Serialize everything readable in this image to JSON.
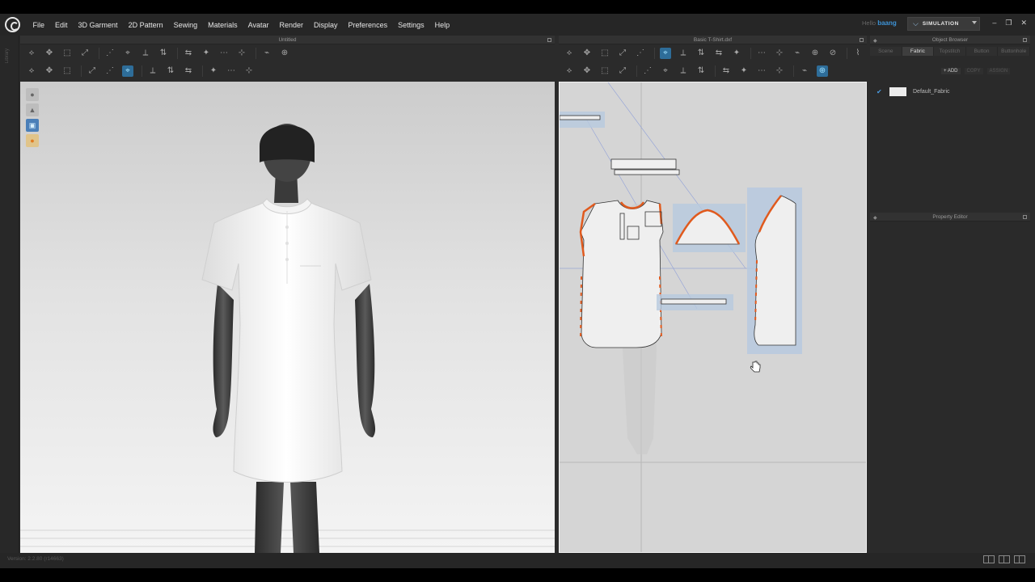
{
  "menu": [
    "File",
    "Edit",
    "3D Garment",
    "2D Pattern",
    "Sewing",
    "Materials",
    "Avatar",
    "Render",
    "Display",
    "Preferences",
    "Settings",
    "Help"
  ],
  "user": {
    "prefix": "Hello",
    "name": "baang"
  },
  "simulation": {
    "label": "SIMULATION"
  },
  "window_controls": [
    "–",
    "❐",
    "✕"
  ],
  "gutter": {
    "label": "Library"
  },
  "panels": {
    "viewport3d_title": "Untitled",
    "viewport2d_title": "Basic T-Shirt.dxf",
    "object_browser_title": "Object Browser",
    "property_editor_title": "Property Editor"
  },
  "object_browser": {
    "tabs": [
      {
        "label": "Scene",
        "active": false
      },
      {
        "label": "Fabric",
        "active": true
      },
      {
        "label": "Topstitch",
        "active": false
      },
      {
        "label": "Button",
        "active": false
      },
      {
        "label": "Buttonhole",
        "active": false
      }
    ],
    "actions": [
      {
        "label": "+ ADD",
        "enabled": true
      },
      {
        "label": "COPY",
        "enabled": false
      },
      {
        "label": "ASSIGN",
        "enabled": false
      }
    ],
    "fabric": {
      "name": "Default_Fabric",
      "swatch_color": "#ececec"
    }
  },
  "status": {
    "version": "Version: 2.2.80 (r14663)"
  },
  "icons": {
    "toolbar3d_row1": [
      "select-mesh-icon",
      "transform-pattern-icon",
      "edit-pattern-icon",
      "sewing-line-icon",
      "segment-sewing-icon",
      "tack-icon",
      "pin-icon",
      "strengthen-icon",
      "fold-arrange-icon",
      "avatar-pose-icon",
      "fit-icon",
      "select-arrangement-point-icon",
      "zipper-icon",
      "measure-icon"
    ],
    "toolbar3d_row2": [
      "edit-sewing-icon",
      "free-sewing-icon",
      "check-sewing-icon",
      "point-icon",
      "line-icon",
      "texture-icon",
      "sphere-icon",
      "button-icon",
      "stitch-line-icon",
      "cut-icon",
      "scissor-icon",
      "select-icon"
    ],
    "toolbar2d_row1": [
      "transform-icon",
      "edit-point-icon",
      "edit-curvature-icon",
      "add-point-icon",
      "curve-point-icon",
      "segment-icon",
      "rectangle-icon",
      "polygon-icon",
      "circle-icon",
      "internal-rectangle-icon",
      "internal-polygon-icon",
      "dart-icon",
      "trace-icon",
      "rotate-icon",
      "internal-line-icon",
      "sync-icon"
    ],
    "toolbar2d_row2": [
      "segment-sewing-icon",
      "free-sewing-icon",
      "m-n-sewing-icon",
      "edit-sewing-icon",
      "check-sewing-icon",
      "notch-icon",
      "topstitch-icon",
      "edit-topstitch-icon",
      "mirror-icon",
      "grid-icon",
      "zoom-icon",
      "snap-icon",
      "layer-icon",
      "arrange-icon"
    ],
    "viewport_tools": [
      "display-avatar-icon",
      "display-garment-icon",
      "display-texture-icon",
      "light-icon"
    ],
    "cursor": "hand-cursor-icon"
  },
  "colors": {
    "accent_blue": "#3d93d6",
    "seam_orange": "#e05a1e",
    "pattern_fill": "#efefef",
    "selection_blue": "#b7c9df"
  }
}
